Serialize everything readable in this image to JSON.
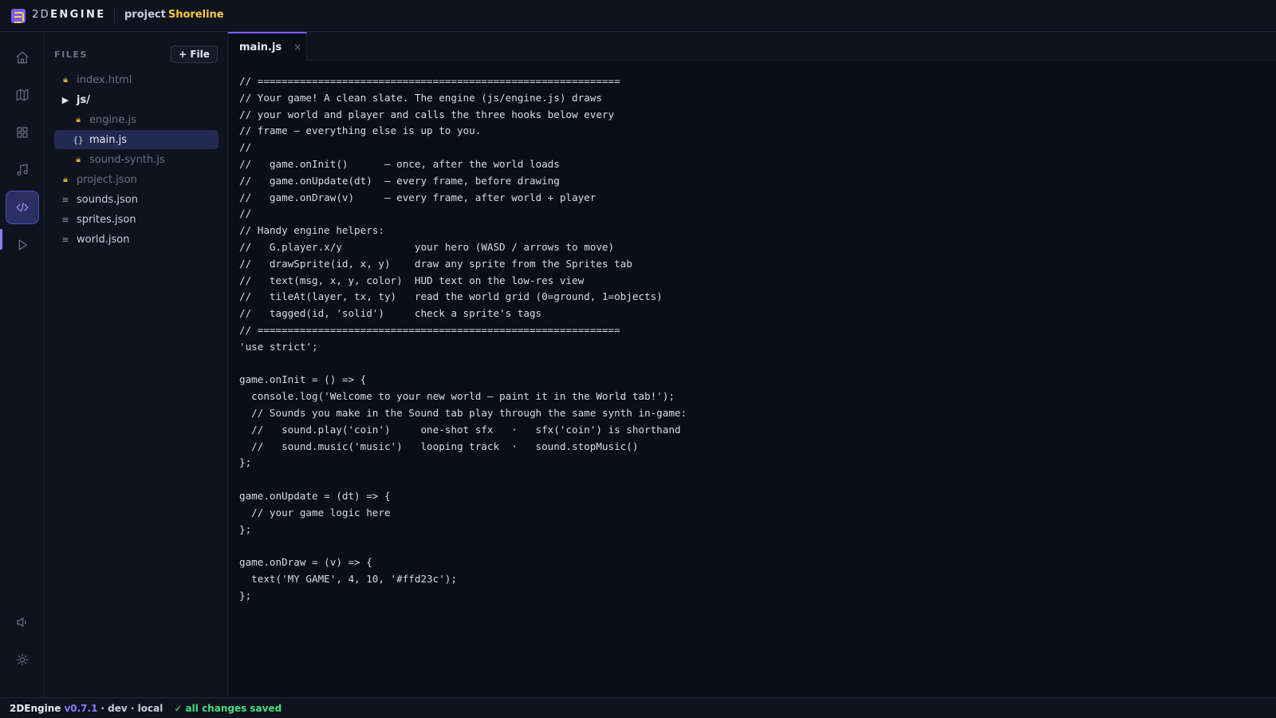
{
  "header": {
    "brand_num": "2D",
    "brand_word": "ENGINE",
    "project_label": "project",
    "project_name": "Shoreline"
  },
  "rail": {
    "items": [
      "home-icon",
      "map-icon",
      "grid-icon",
      "music-icon",
      "code-icon",
      "play-icon"
    ],
    "bottom_items": [
      "speaker-icon",
      "sun-icon"
    ],
    "active": "code-icon"
  },
  "files": {
    "title": "FILES",
    "add_label": "+ File",
    "items": [
      {
        "name": "index.html",
        "icon": "lock-icon",
        "locked": true
      },
      {
        "name": "js/",
        "icon": "caret-right-icon",
        "folder": true
      },
      {
        "name": "engine.js",
        "icon": "lock-icon",
        "locked": true,
        "indent": true
      },
      {
        "name": "main.js",
        "icon": "braces-icon",
        "selected": true,
        "indent": true
      },
      {
        "name": "sound-synth.js",
        "icon": "lock-icon",
        "locked": true,
        "indent": true
      },
      {
        "name": "project.json",
        "icon": "lock-icon",
        "locked": true
      },
      {
        "name": "sounds.json",
        "icon": "lines-icon"
      },
      {
        "name": "sprites.json",
        "icon": "lines-icon"
      },
      {
        "name": "world.json",
        "icon": "lines-icon"
      }
    ]
  },
  "editor": {
    "tab_label": "main.js",
    "tab_close": "×",
    "code_lines": [
      "// ============================================================",
      "// Your game! A clean slate. The engine (js/engine.js) draws",
      "// your world and player and calls the three hooks below every",
      "// frame — everything else is up to you.",
      "//",
      "//   game.onInit()      — once, after the world loads",
      "//   game.onUpdate(dt)  — every frame, before drawing",
      "//   game.onDraw(v)     — every frame, after world + player",
      "//",
      "// Handy engine helpers:",
      "//   G.player.x/y            your hero (WASD / arrows to move)",
      "//   drawSprite(id, x, y)    draw any sprite from the Sprites tab",
      "//   text(msg, x, y, color)  HUD text on the low-res view",
      "//   tileAt(layer, tx, ty)   read the world grid (0=ground, 1=objects)",
      "//   tagged(id, 'solid')     check a sprite's tags",
      "// ============================================================",
      "'use strict';",
      "",
      "game.onInit = () => {",
      "  console.log('Welcome to your new world — paint it in the World tab!');",
      "  // Sounds you make in the Sound tab play through the same synth in-game:",
      "  //   sound.play('coin')     one-shot sfx   ·   sfx('coin') is shorthand",
      "  //   sound.music('music')   looping track  ·   sound.stopMusic()",
      "};",
      "",
      "game.onUpdate = (dt) => {",
      "  // your game logic here",
      "};",
      "",
      "game.onDraw = (v) => {",
      "  text('MY GAME', 4, 10, '#ffd23c');",
      "};"
    ]
  },
  "status": {
    "app": "2DEngine",
    "version": "v0.7.1",
    "env": "· dev · local",
    "saved": "✓ all changes saved"
  },
  "colors": {
    "accent": "#7c5cf5",
    "project_name": "#f6c93e",
    "saved": "#4ade80",
    "lock": "#d5a83a"
  }
}
